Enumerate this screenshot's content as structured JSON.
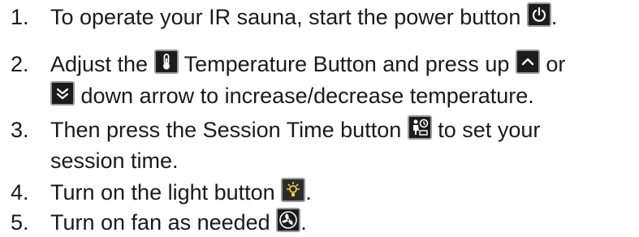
{
  "steps": [
    {
      "number": "1.",
      "text_a": "To operate your IR sauna, start the power button",
      "text_b": ".",
      "icon": "power-icon"
    },
    {
      "number": "2.",
      "text_a": "Adjust the",
      "text_b": "Temperature Button and press up",
      "text_c": "or",
      "icon_1": "thermometer-icon",
      "icon_2": "up-arrow-icon",
      "line2_text": "down arrow to increase/decrease temperature.",
      "icon_3": "down-arrow-icon"
    },
    {
      "number": "3.",
      "text_a": "Then press the Session Time button",
      "text_b": "to set your",
      "icon": "session-time-icon",
      "line2_text": "session time."
    },
    {
      "number": "4.",
      "text_a": "Turn on the light button",
      "text_b": ".",
      "icon": "light-bulb-icon"
    },
    {
      "number": "5.",
      "text_a": "Turn on fan as needed",
      "text_b": ".",
      "icon": "fan-icon"
    }
  ],
  "colors": {
    "text": "#1a1a1a",
    "icon_bg": "#1c1c1c",
    "icon_border": "#9a9a9a",
    "icon_glyph": "#ffffff"
  }
}
